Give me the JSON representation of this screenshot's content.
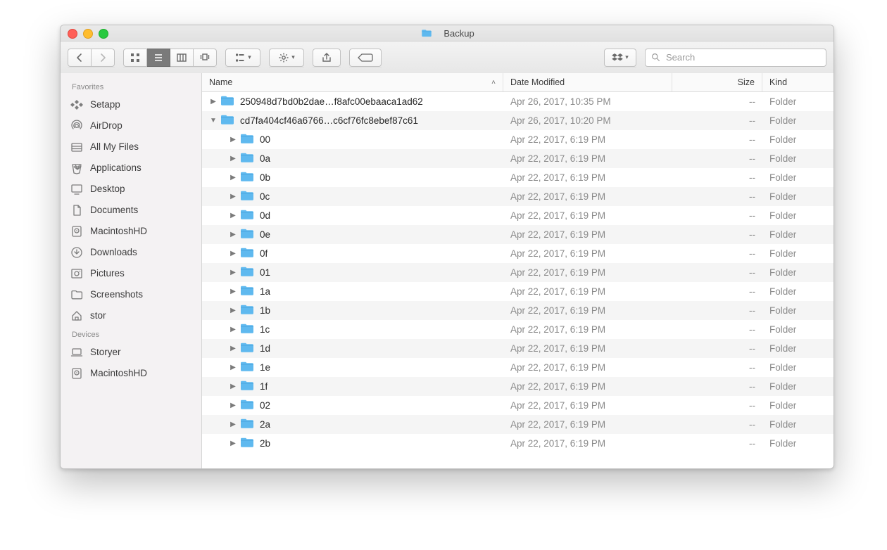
{
  "window": {
    "title": "Backup"
  },
  "toolbar": {
    "search_placeholder": "Search"
  },
  "columns": {
    "name": "Name",
    "date": "Date Modified",
    "size": "Size",
    "kind": "Kind"
  },
  "folder_icon_color": "#5fb9ef",
  "sidebar": {
    "sections": [
      {
        "title": "Favorites",
        "items": [
          {
            "icon": "setapp",
            "label": "Setapp"
          },
          {
            "icon": "airdrop",
            "label": "AirDrop"
          },
          {
            "icon": "all-my-files",
            "label": "All My Files"
          },
          {
            "icon": "applications",
            "label": "Applications"
          },
          {
            "icon": "desktop",
            "label": "Desktop"
          },
          {
            "icon": "documents",
            "label": "Documents"
          },
          {
            "icon": "disk",
            "label": "MacintoshHD"
          },
          {
            "icon": "downloads",
            "label": "Downloads"
          },
          {
            "icon": "pictures",
            "label": "Pictures"
          },
          {
            "icon": "folder",
            "label": "Screenshots"
          },
          {
            "icon": "home",
            "label": "stor"
          }
        ]
      },
      {
        "title": "Devices",
        "items": [
          {
            "icon": "laptop",
            "label": "Storyer"
          },
          {
            "icon": "disk",
            "label": "MacintoshHD"
          }
        ]
      }
    ]
  },
  "rows": [
    {
      "level": 0,
      "expanded": false,
      "name": "250948d7bd0b2dae…f8afc00ebaaca1ad62",
      "date": "Apr 26, 2017, 10:35 PM",
      "size": "--",
      "kind": "Folder"
    },
    {
      "level": 0,
      "expanded": true,
      "name": "cd7fa404cf46a6766…c6cf76fc8ebef87c61",
      "date": "Apr 26, 2017, 10:20 PM",
      "size": "--",
      "kind": "Folder"
    },
    {
      "level": 1,
      "expanded": false,
      "name": "00",
      "date": "Apr 22, 2017, 6:19 PM",
      "size": "--",
      "kind": "Folder"
    },
    {
      "level": 1,
      "expanded": false,
      "name": "0a",
      "date": "Apr 22, 2017, 6:19 PM",
      "size": "--",
      "kind": "Folder"
    },
    {
      "level": 1,
      "expanded": false,
      "name": "0b",
      "date": "Apr 22, 2017, 6:19 PM",
      "size": "--",
      "kind": "Folder"
    },
    {
      "level": 1,
      "expanded": false,
      "name": "0c",
      "date": "Apr 22, 2017, 6:19 PM",
      "size": "--",
      "kind": "Folder"
    },
    {
      "level": 1,
      "expanded": false,
      "name": "0d",
      "date": "Apr 22, 2017, 6:19 PM",
      "size": "--",
      "kind": "Folder"
    },
    {
      "level": 1,
      "expanded": false,
      "name": "0e",
      "date": "Apr 22, 2017, 6:19 PM",
      "size": "--",
      "kind": "Folder"
    },
    {
      "level": 1,
      "expanded": false,
      "name": "0f",
      "date": "Apr 22, 2017, 6:19 PM",
      "size": "--",
      "kind": "Folder"
    },
    {
      "level": 1,
      "expanded": false,
      "name": "01",
      "date": "Apr 22, 2017, 6:19 PM",
      "size": "--",
      "kind": "Folder"
    },
    {
      "level": 1,
      "expanded": false,
      "name": "1a",
      "date": "Apr 22, 2017, 6:19 PM",
      "size": "--",
      "kind": "Folder"
    },
    {
      "level": 1,
      "expanded": false,
      "name": "1b",
      "date": "Apr 22, 2017, 6:19 PM",
      "size": "--",
      "kind": "Folder"
    },
    {
      "level": 1,
      "expanded": false,
      "name": "1c",
      "date": "Apr 22, 2017, 6:19 PM",
      "size": "--",
      "kind": "Folder"
    },
    {
      "level": 1,
      "expanded": false,
      "name": "1d",
      "date": "Apr 22, 2017, 6:19 PM",
      "size": "--",
      "kind": "Folder"
    },
    {
      "level": 1,
      "expanded": false,
      "name": "1e",
      "date": "Apr 22, 2017, 6:19 PM",
      "size": "--",
      "kind": "Folder"
    },
    {
      "level": 1,
      "expanded": false,
      "name": "1f",
      "date": "Apr 22, 2017, 6:19 PM",
      "size": "--",
      "kind": "Folder"
    },
    {
      "level": 1,
      "expanded": false,
      "name": "02",
      "date": "Apr 22, 2017, 6:19 PM",
      "size": "--",
      "kind": "Folder"
    },
    {
      "level": 1,
      "expanded": false,
      "name": "2a",
      "date": "Apr 22, 2017, 6:19 PM",
      "size": "--",
      "kind": "Folder"
    },
    {
      "level": 1,
      "expanded": false,
      "name": "2b",
      "date": "Apr 22, 2017, 6:19 PM",
      "size": "--",
      "kind": "Folder"
    }
  ]
}
